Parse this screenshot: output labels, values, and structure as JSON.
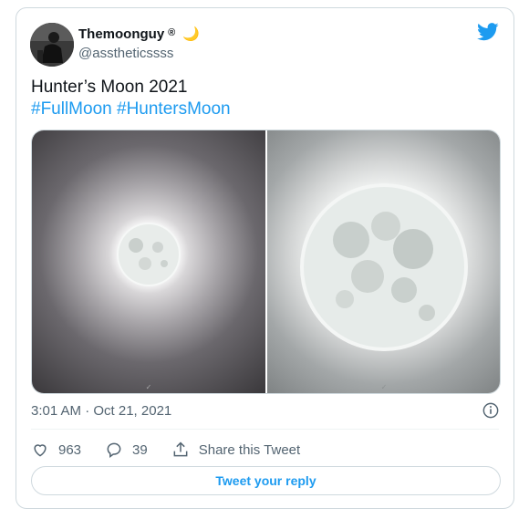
{
  "author": {
    "display_name": "Themoonguy",
    "badge": "®",
    "emoji": "🌙",
    "handle": "@asstheticssss",
    "avatar_icon": "avatar-photo"
  },
  "tweet": {
    "text_line1": "Hunter’s Moon 2021",
    "hashtags": [
      "#FullMoon",
      "#HuntersMoon"
    ]
  },
  "media": {
    "images": [
      {
        "name": "moon-photo-small"
      },
      {
        "name": "moon-photo-large"
      }
    ]
  },
  "timestamp": "3:01 AM · Oct 21, 2021",
  "actions": {
    "likes": "963",
    "replies": "39",
    "share_label": "Share this Tweet"
  },
  "reply_button": "Tweet your reply",
  "colors": {
    "accent": "#1d9bf0",
    "muted": "#536471",
    "border": "#cfd9de"
  }
}
